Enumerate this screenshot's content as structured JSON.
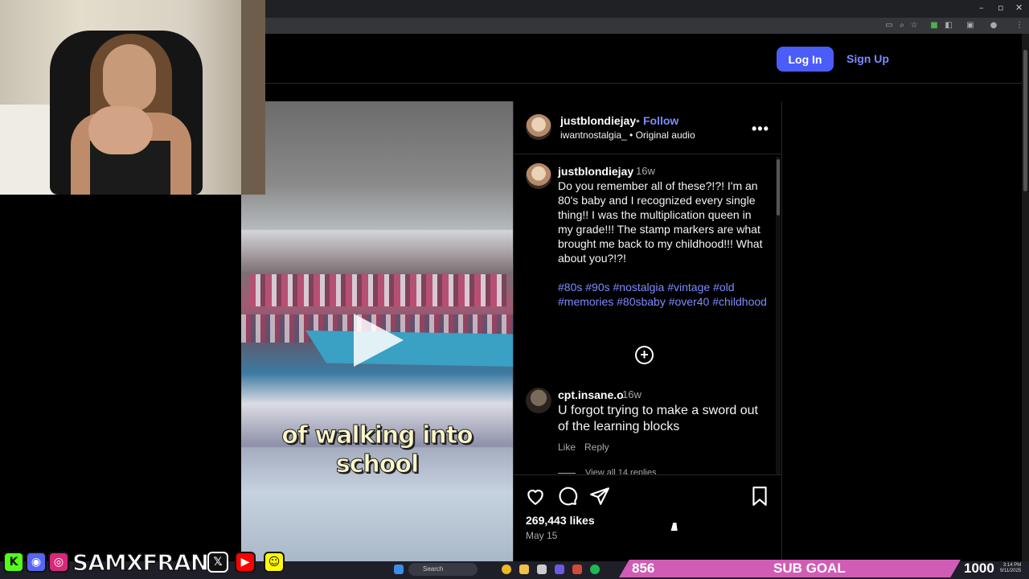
{
  "header": {
    "login_label": "Log In",
    "signup_label": "Sign Up"
  },
  "post": {
    "author": "justblondiejay",
    "separator": "•",
    "follow_label": "Follow",
    "audio_line": "iwantnostalgia_ • Original audio",
    "more_label": "•••",
    "video_caption_line1": "of walking into",
    "video_caption_line2": "school",
    "caption": {
      "user": "justblondiejay",
      "time": "16w",
      "text": "Do you remember all of these?!?! I'm an 80's baby and I recognized every single thing!! I was the multiplication queen in my grade!!! The stamp markers are what brought me back to my childhood!!! What about you?!?!",
      "tags": "#80s #90s #nostalgia #vintage #old #memories #80sbaby #over40 #childhood"
    },
    "load_more_label": "+",
    "comment": {
      "user": "cpt.insane.o",
      "time": "16w",
      "text": "U forgot trying to make a sword out of the learning blocks",
      "like_label": "Like",
      "reply_label": "Reply",
      "view_replies": "View all 14 replies"
    },
    "likes": "269,443 likes",
    "date": "May 15"
  },
  "overlay": {
    "handle": "SAMXFRANK",
    "sub_count": "856",
    "sub_goal_label": "SUB GOAL",
    "sub_target": "1000"
  },
  "taskbar": {
    "search_placeholder": "Search",
    "clock_time": "3:14 PM",
    "clock_date": "9/11/2025"
  },
  "colors": {
    "accent": "#4a5df9",
    "link": "#7c8cff",
    "sub_bar": "#d05db5"
  }
}
